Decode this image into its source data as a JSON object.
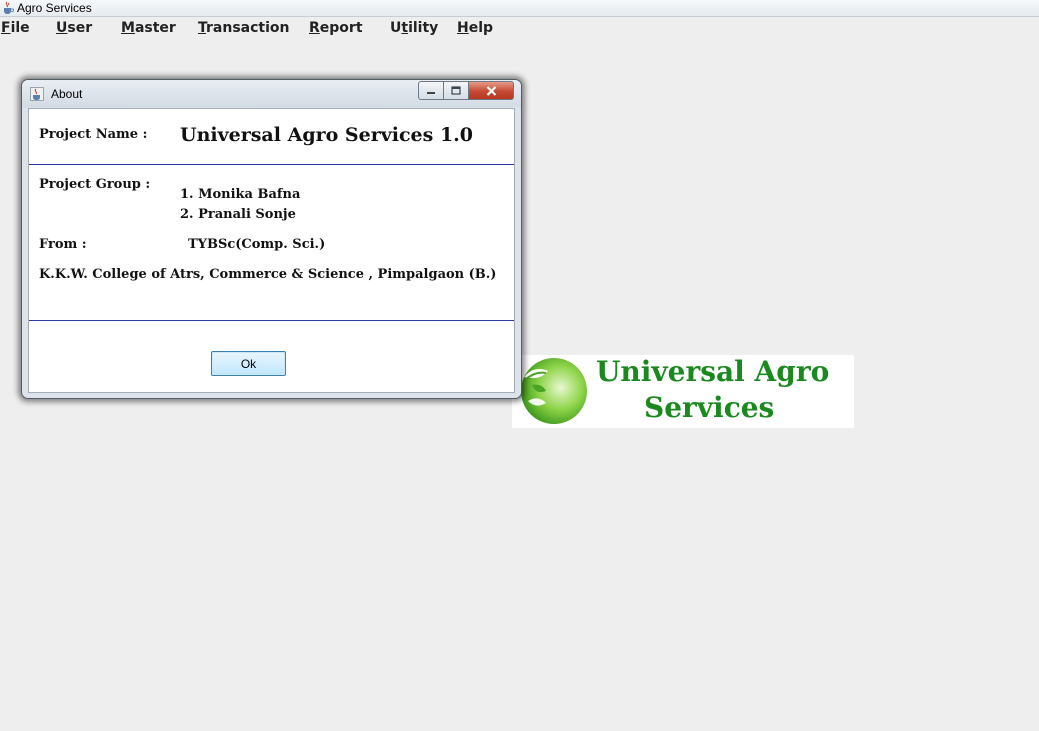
{
  "app": {
    "window_title": "Agro Services",
    "icon": "java-coffee-icon"
  },
  "menu": {
    "items": [
      {
        "label_mn": "F",
        "label_rest": "ile"
      },
      {
        "label_mn": "U",
        "label_rest": "ser"
      },
      {
        "label_mn": "M",
        "label_rest": "aster"
      },
      {
        "label_mn": "T",
        "label_rest": "ransaction"
      },
      {
        "label_mn": "R",
        "label_rest": "eport"
      },
      {
        "label_pre": "U",
        "label_mn": "t",
        "label_rest": "ility"
      },
      {
        "label_mn": "H",
        "label_rest": "elp"
      }
    ]
  },
  "about_dialog": {
    "title": "About",
    "project_name_label": "Project Name :",
    "project_name_value": "Universal Agro Services 1.0",
    "project_group_label": "Project Group :",
    "members": [
      "1. Monika Bafna",
      "2. Pranali Sonje"
    ],
    "from_label": "From :",
    "from_value": "TYBSc(Comp. Sci.)",
    "college": "K.K.W. College of Atrs, Commerce & Science , Pimpalgaon (B.)",
    "ok_label": "Ok",
    "window_buttons": {
      "minimize": "minimize-icon",
      "maximize": "maximize-icon",
      "close": "close-icon"
    }
  },
  "logo": {
    "line1": "Universal Agro",
    "line2": "Services",
    "colors": {
      "text": "#1a8a1f",
      "leaf": "#5fc02e"
    }
  }
}
